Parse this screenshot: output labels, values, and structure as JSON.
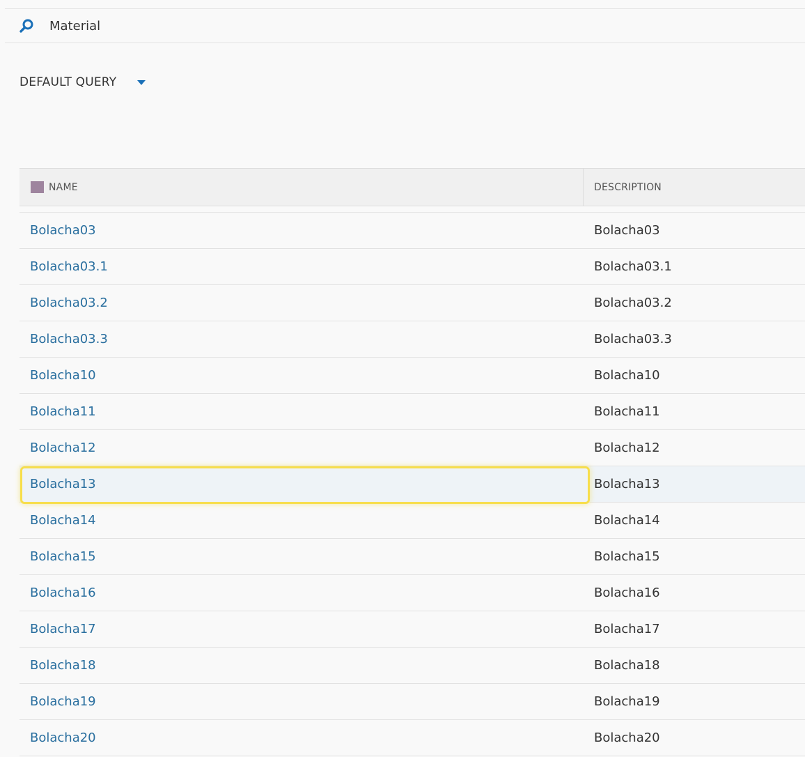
{
  "search": {
    "label": "Material",
    "icon": "search-icon",
    "icon_color": "#1a70b8"
  },
  "query": {
    "label": "DEFAULT QUERY",
    "icon": "chevron-down-icon"
  },
  "table": {
    "columns": {
      "name": "NAME",
      "description": "DESCRIPTION"
    },
    "header_swatch_color": "#9e849e",
    "link_color": "#2a6f9f",
    "highlight_color": "#f7de4c",
    "rows": [
      {
        "name": "Bolacha03",
        "description": "Bolacha03"
      },
      {
        "name": "Bolacha03.1",
        "description": "Bolacha03.1"
      },
      {
        "name": "Bolacha03.2",
        "description": "Bolacha03.2"
      },
      {
        "name": "Bolacha03.3",
        "description": "Bolacha03.3"
      },
      {
        "name": "Bolacha10",
        "description": "Bolacha10"
      },
      {
        "name": "Bolacha11",
        "description": "Bolacha11"
      },
      {
        "name": "Bolacha12",
        "description": "Bolacha12"
      },
      {
        "name": "Bolacha13",
        "description": "Bolacha13"
      },
      {
        "name": "Bolacha14",
        "description": "Bolacha14"
      },
      {
        "name": "Bolacha15",
        "description": "Bolacha15"
      },
      {
        "name": "Bolacha16",
        "description": "Bolacha16"
      },
      {
        "name": "Bolacha17",
        "description": "Bolacha17"
      },
      {
        "name": "Bolacha18",
        "description": "Bolacha18"
      },
      {
        "name": "Bolacha19",
        "description": "Bolacha19"
      },
      {
        "name": "Bolacha20",
        "description": "Bolacha20"
      }
    ]
  }
}
